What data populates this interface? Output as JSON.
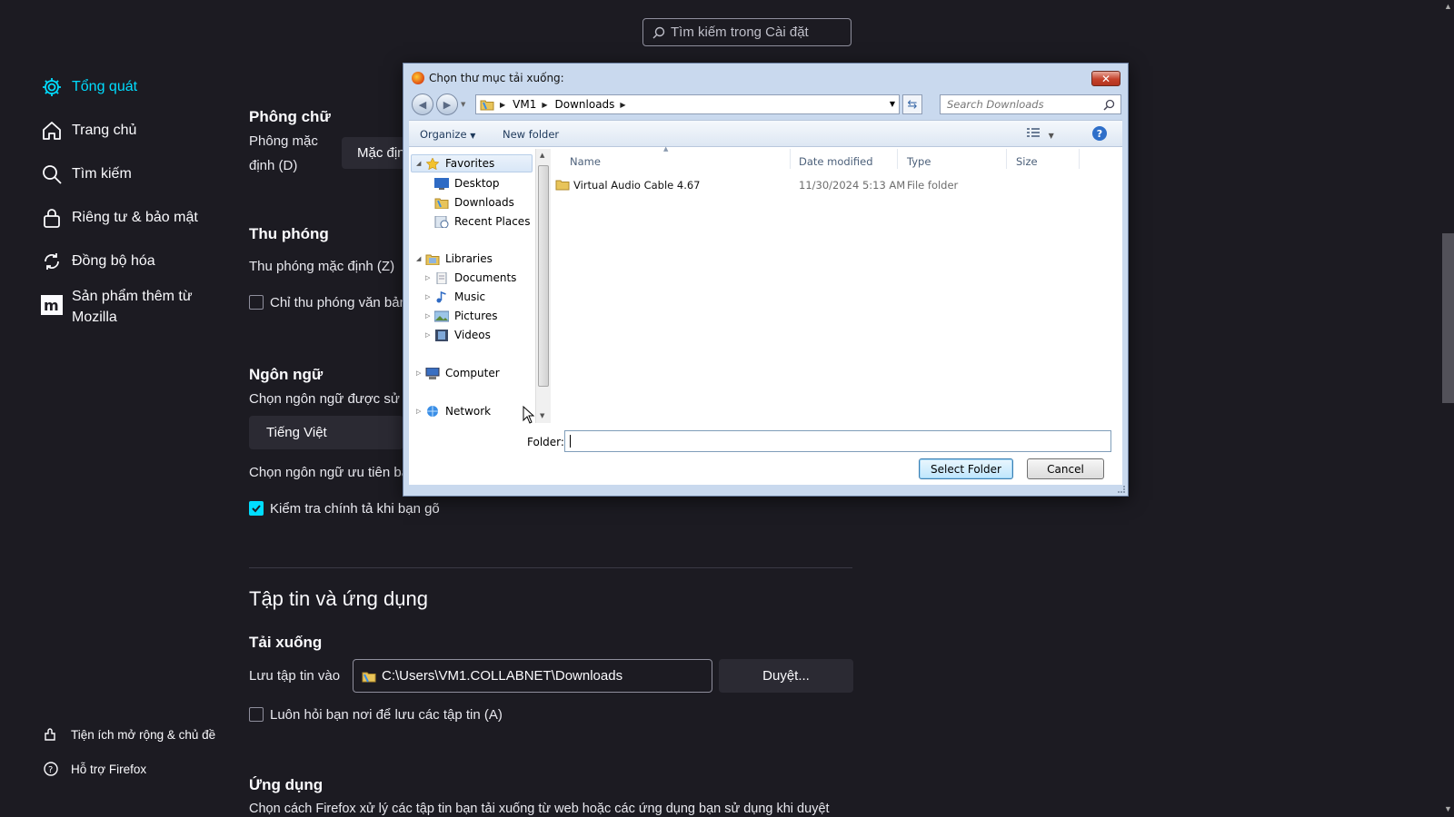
{
  "settings": {
    "search_placeholder": "Tìm kiếm trong Cài đặt",
    "nav": [
      {
        "label": "Tổng quát",
        "icon": "gear-icon",
        "active": true
      },
      {
        "label": "Trang chủ",
        "icon": "home-icon",
        "active": false
      },
      {
        "label": "Tìm kiếm",
        "icon": "search-icon",
        "active": false
      },
      {
        "label": "Riêng tư & bảo mật",
        "icon": "lock-icon",
        "active": false
      },
      {
        "label": "Đồng bộ hóa",
        "icon": "sync-icon",
        "active": false
      },
      {
        "label_line1": "Sản phẩm thêm từ",
        "label_line2": "Mozilla",
        "icon": "mozilla-icon",
        "active": false
      }
    ],
    "footer_nav": [
      {
        "label": "Tiện ích mở rộng & chủ đề",
        "icon": "puzzle-icon"
      },
      {
        "label": "Hỗ trợ Firefox",
        "icon": "help-icon"
      }
    ],
    "fonts": {
      "heading": "Phông chữ",
      "default_line1": "Phông mặc",
      "default_line2": "định (D)",
      "default_value": "Mặc địn"
    },
    "zoom": {
      "heading": "Thu phóng",
      "default_label": "Thu phóng mặc định (Z)",
      "text_only_label": "Chỉ thu phóng văn bản"
    },
    "language": {
      "heading": "Ngôn ngữ",
      "choose_label": "Chọn ngôn ngữ được sử d",
      "current": "Tiếng Việt",
      "preferred_label": "Chọn ngôn ngữ ưu tiên bạ",
      "spellcheck_label": "Kiểm tra chính tả khi bạn gõ",
      "spellcheck_checked": true
    },
    "files_apps": {
      "heading": "Tập tin và ứng dụng",
      "downloads_heading": "Tải xuống",
      "save_to_label": "Lưu tập tin vào",
      "save_path": "C:\\Users\\VM1.COLLABNET\\Downloads",
      "browse_button": "Duyệt...",
      "always_ask_label": "Luôn hỏi bạn nơi để lưu các tập tin (A)",
      "always_ask_checked": false,
      "apps_heading": "Ứng dụng",
      "apps_desc": "Chọn cách Firefox xử lý các tập tin bạn tải xuống từ web hoặc các ứng dụng bạn sử dụng khi duyệt"
    }
  },
  "dialog": {
    "title": "Chọn thư mục tải xuống:",
    "breadcrumb": [
      "VM1",
      "Downloads"
    ],
    "search_placeholder": "Search Downloads",
    "toolbar": {
      "organize": "Organize",
      "new_folder": "New folder"
    },
    "tree": {
      "favorites": "Favorites",
      "desktop": "Desktop",
      "downloads": "Downloads",
      "recent": "Recent Places",
      "libraries": "Libraries",
      "documents": "Documents",
      "music": "Music",
      "pictures": "Pictures",
      "videos": "Videos",
      "computer": "Computer",
      "network": "Network"
    },
    "columns": {
      "name": "Name",
      "date": "Date modified",
      "type": "Type",
      "size": "Size"
    },
    "rows": [
      {
        "name": "Virtual Audio Cable 4.67",
        "date": "11/30/2024 5:13 AM",
        "type": "File folder",
        "size": ""
      }
    ],
    "folder_label": "Folder:",
    "folder_value": "",
    "select_button": "Select Folder",
    "cancel_button": "Cancel",
    "close_button": "✕"
  }
}
